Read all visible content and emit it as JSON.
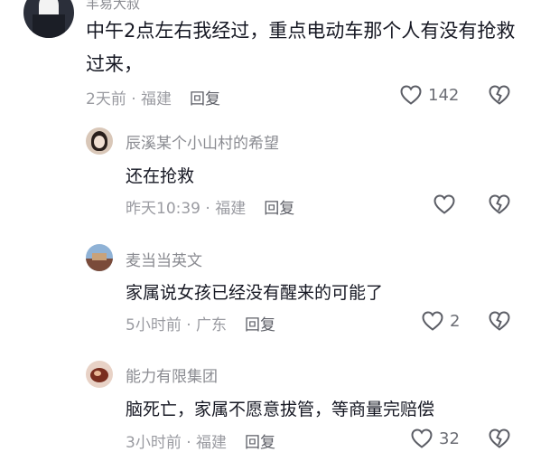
{
  "comments": [
    {
      "author": "羊易大叔",
      "text": "中午2点左右我经过，重点电动车那个人有没有抢救过来，",
      "time": "2天前",
      "location": "福建",
      "reply_label": "回复",
      "likes": "142",
      "replies": [
        {
          "author": "辰溪某个小山村的希望",
          "text": "还在抢救",
          "time": "昨天10:39",
          "location": "福建",
          "reply_label": "回复",
          "likes": ""
        },
        {
          "author": "麦当当英文",
          "text": "家属说女孩已经没有醒来的可能了",
          "time": "5小时前",
          "location": "广东",
          "reply_label": "回复",
          "likes": "2"
        },
        {
          "author": "能力有限集团",
          "text": "脑死亡，家属不愿意拔管，等商量完赔偿",
          "time": "3小时前",
          "location": "福建",
          "reply_label": "回复",
          "likes": "32"
        }
      ]
    }
  ],
  "separator": " · "
}
